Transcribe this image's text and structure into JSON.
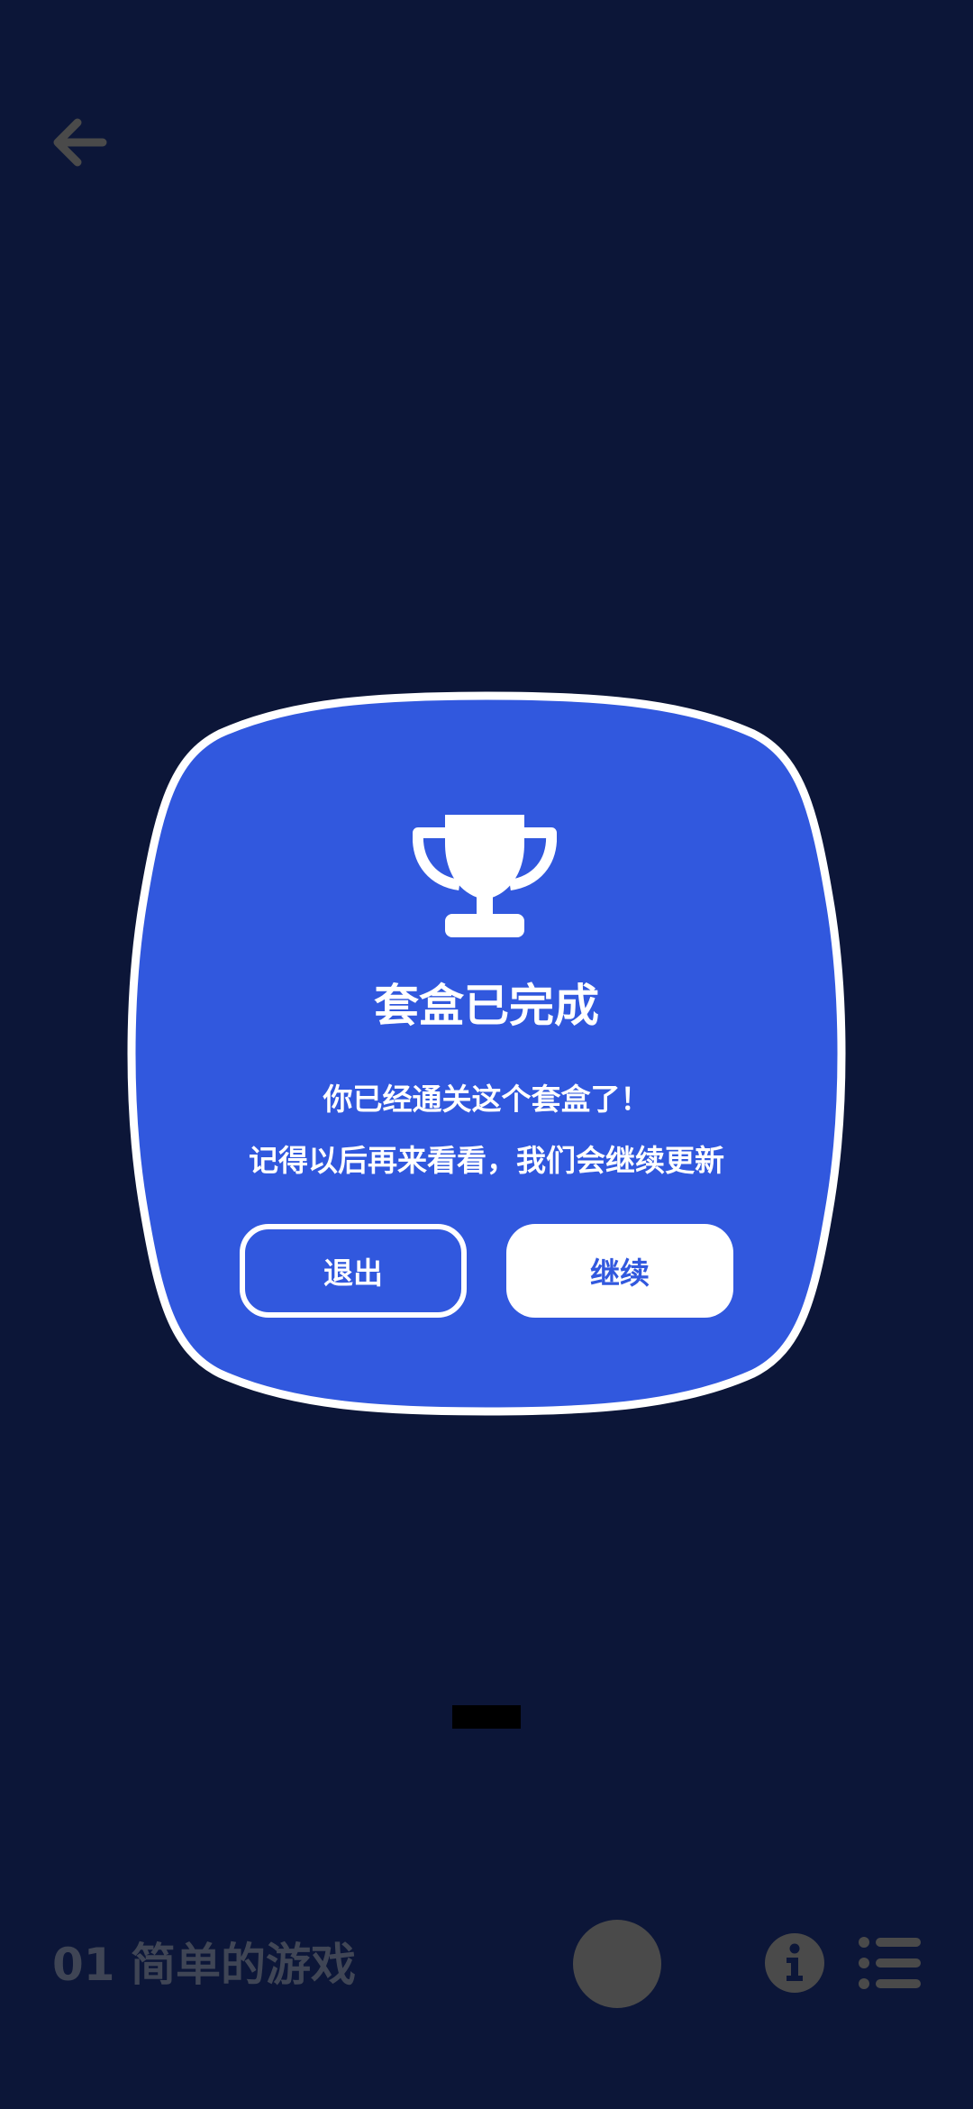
{
  "header": {
    "back_icon": "arrow-left-icon"
  },
  "dialog": {
    "icon": "trophy-icon",
    "title": "套盒已完成",
    "message_line1": "你已经通关这个套盒了！",
    "message_line2": "记得以后再来看看，我们会继续更新",
    "exit_label": "退出",
    "continue_label": "继续",
    "background_color": "#3158de",
    "border_color": "#ffffff"
  },
  "footer": {
    "level_title": "01 简单的游戏",
    "info_icon": "info-icon",
    "list_icon": "list-icon"
  },
  "colors": {
    "page_background": "#0c1638",
    "dim_text": "#3f4555",
    "dim_icon": "#4a4a4a"
  }
}
